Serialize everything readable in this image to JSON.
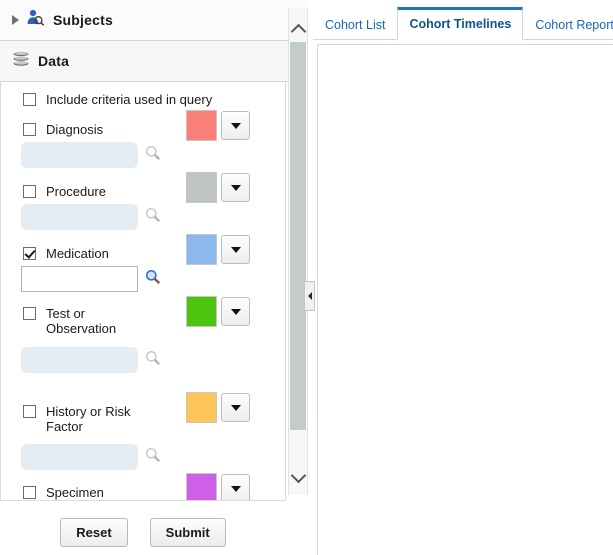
{
  "left_panel": {
    "sections": [
      {
        "title": "Subjects",
        "icon": "subjects-person-search-icon",
        "expanded": false
      },
      {
        "title": "Data",
        "icon": "data-stack-icon",
        "expanded": true
      }
    ],
    "include_criteria": {
      "label": "Include criteria used in query",
      "checked": false
    },
    "criteria": [
      {
        "label": "Diagnosis",
        "checked": false,
        "color": "#fb7f79",
        "input_value": "",
        "input_placeholder": "",
        "input_enabled": false,
        "search_icon": "magnifier-icon",
        "dropdown_icon": "chevron-down-icon"
      },
      {
        "label": "Procedure",
        "checked": false,
        "color": "#bdc4c2",
        "input_value": "",
        "input_placeholder": "",
        "input_enabled": false,
        "search_icon": "magnifier-icon",
        "dropdown_icon": "chevron-down-icon"
      },
      {
        "label": "Medication",
        "checked": true,
        "color": "#8cb9ed",
        "input_value": "",
        "input_placeholder": "",
        "input_enabled": true,
        "search_icon": "magnifier-icon",
        "dropdown_icon": "chevron-down-icon"
      },
      {
        "label": "Test or Observation",
        "checked": false,
        "color": "#4fc410",
        "input_value": "",
        "input_placeholder": "",
        "input_enabled": false,
        "search_icon": "magnifier-icon",
        "dropdown_icon": "chevron-down-icon"
      },
      {
        "label": "History or Risk Factor",
        "checked": false,
        "color": "#fcc55a",
        "input_value": "",
        "input_placeholder": "",
        "input_enabled": false,
        "search_icon": "magnifier-icon",
        "dropdown_icon": "chevron-down-icon"
      },
      {
        "label": "Specimen",
        "checked": false,
        "color": "#cd5fe8",
        "input_value": "",
        "input_placeholder": "",
        "input_enabled": false,
        "search_icon": "magnifier-icon",
        "dropdown_icon": "chevron-down-icon"
      }
    ],
    "buttons": {
      "reset": "Reset",
      "submit": "Submit"
    },
    "scrollbar": {
      "up_icon": "chevron-up-icon",
      "down_icon": "chevron-down-icon"
    },
    "collapse_handle": {
      "icon": "collapse-left-arrow-icon"
    }
  },
  "right_panel": {
    "tabs": [
      {
        "label": "Cohort List",
        "active": false
      },
      {
        "label": "Cohort Timelines",
        "active": true
      },
      {
        "label": "Cohort Reports",
        "active": false
      }
    ],
    "content": ""
  },
  "colors": {
    "accent": "#1778c4",
    "tab_text": "#1668b8",
    "panel_border": "#d3dce6"
  }
}
